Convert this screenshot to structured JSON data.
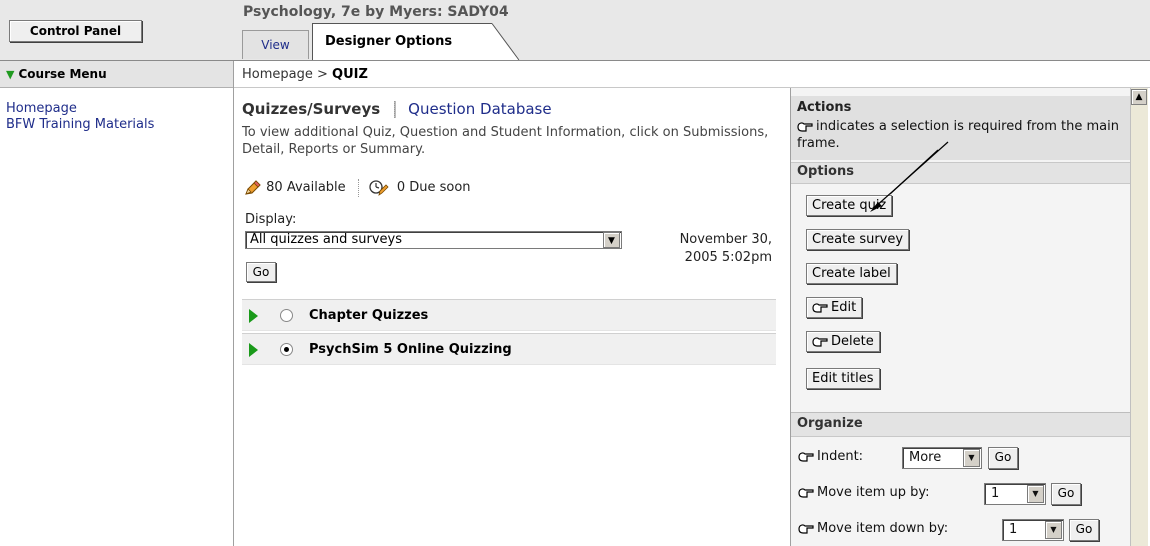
{
  "header": {
    "control_panel_label": "Control Panel",
    "course_title": "Psychology, 7e by Myers: SADY04",
    "tabs": [
      {
        "label": "View",
        "active": false
      },
      {
        "label": "Designer Options",
        "active": true
      }
    ]
  },
  "course_menu": {
    "title": "Course Menu",
    "items": [
      {
        "label": "Homepage"
      },
      {
        "label": "BFW Training Materials"
      }
    ]
  },
  "breadcrumb": {
    "home": "Homepage",
    "separator": " > ",
    "current": "QUIZ"
  },
  "main": {
    "tabs": [
      {
        "label": "Quizzes/Surveys",
        "active": true
      },
      {
        "label": "Question Database",
        "active": false
      }
    ],
    "instructions": "To view additional Quiz, Question and Student Information, click on Submissions, Detail, Reports or Summary.",
    "available": "80 Available",
    "due_soon": "0 Due soon",
    "display_label": "Display:",
    "display_value": "All quizzes and surveys",
    "date_line1": "November 30,",
    "date_line2": "2005 5:02pm",
    "go_label": "Go",
    "quiz_rows": [
      {
        "label": "Chapter Quizzes",
        "selected": false
      },
      {
        "label": "PsychSim 5 Online Quizzing",
        "selected": true
      }
    ]
  },
  "actions_panel": {
    "title": "Actions",
    "description": "indicates a selection is required from the main frame.",
    "options_title": "Options",
    "buttons": [
      {
        "label": "Create quiz"
      },
      {
        "label": "Create survey"
      },
      {
        "label": "Create label"
      },
      {
        "label": "Edit"
      },
      {
        "label": "Delete"
      },
      {
        "label": "Edit titles"
      }
    ],
    "organize_title": "Organize",
    "organize_rows": [
      {
        "label": "Indent:",
        "value": "More",
        "go": "Go"
      },
      {
        "label": "Move item up by:",
        "value": "1",
        "go": "Go"
      },
      {
        "label": "Move item down by:",
        "value": "1",
        "go": "Go"
      }
    ]
  },
  "colors": {
    "link": "#1f2d8a",
    "play_green": "#1a9a1a",
    "panel_gray": "#e3e3e3"
  }
}
